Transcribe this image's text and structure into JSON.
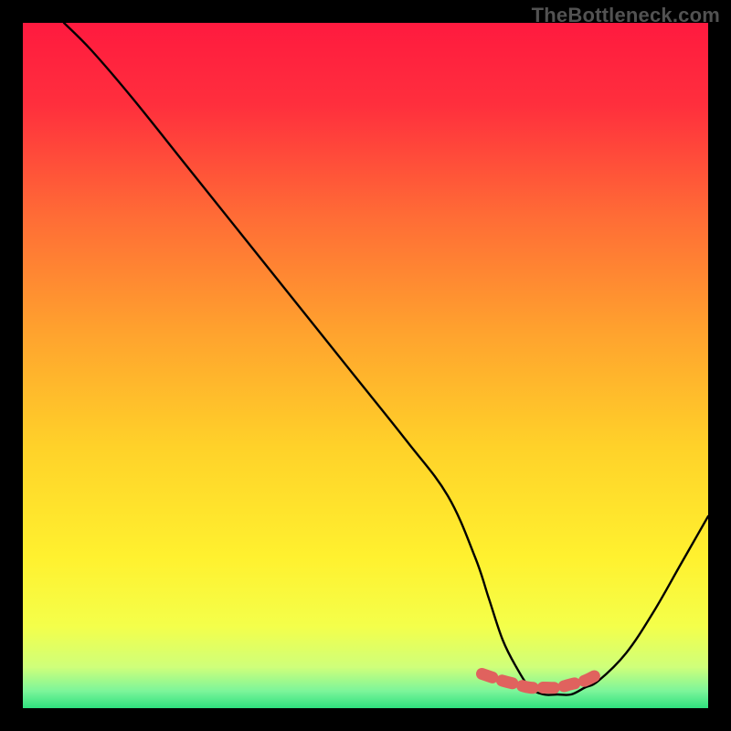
{
  "watermark": "TheBottleneck.com",
  "chart_data": {
    "type": "line",
    "title": "",
    "xlabel": "",
    "ylabel": "",
    "xlim": [
      0,
      100
    ],
    "ylim": [
      0,
      100
    ],
    "grid": false,
    "series": [
      {
        "name": "bottleneck-curve",
        "x": [
          6,
          10,
          16,
          24,
          32,
          40,
          48,
          56,
          62,
          66,
          68,
          70,
          72,
          74,
          76,
          78,
          80,
          82,
          84,
          88,
          92,
          96,
          100
        ],
        "y": [
          100,
          96,
          89,
          79,
          69,
          59,
          49,
          39,
          31,
          22,
          16,
          10,
          6,
          3,
          2,
          2,
          2,
          3,
          4,
          8,
          14,
          21,
          28
        ]
      }
    ],
    "markers": {
      "name": "highlight-band",
      "x": [
        67,
        70,
        72,
        74,
        76,
        78,
        80,
        82,
        84
      ],
      "y": [
        5,
        4,
        3.5,
        3,
        3,
        3,
        3.5,
        4,
        5
      ]
    },
    "gradient_stops": [
      {
        "offset": 0.0,
        "color": "#ff1a3f"
      },
      {
        "offset": 0.12,
        "color": "#ff2f3d"
      },
      {
        "offset": 0.28,
        "color": "#ff6b36"
      },
      {
        "offset": 0.45,
        "color": "#ffa22e"
      },
      {
        "offset": 0.62,
        "color": "#ffd229"
      },
      {
        "offset": 0.78,
        "color": "#fff12f"
      },
      {
        "offset": 0.88,
        "color": "#f4ff4a"
      },
      {
        "offset": 0.94,
        "color": "#cfff7a"
      },
      {
        "offset": 0.975,
        "color": "#7cf59a"
      },
      {
        "offset": 1.0,
        "color": "#2fe07e"
      }
    ]
  }
}
